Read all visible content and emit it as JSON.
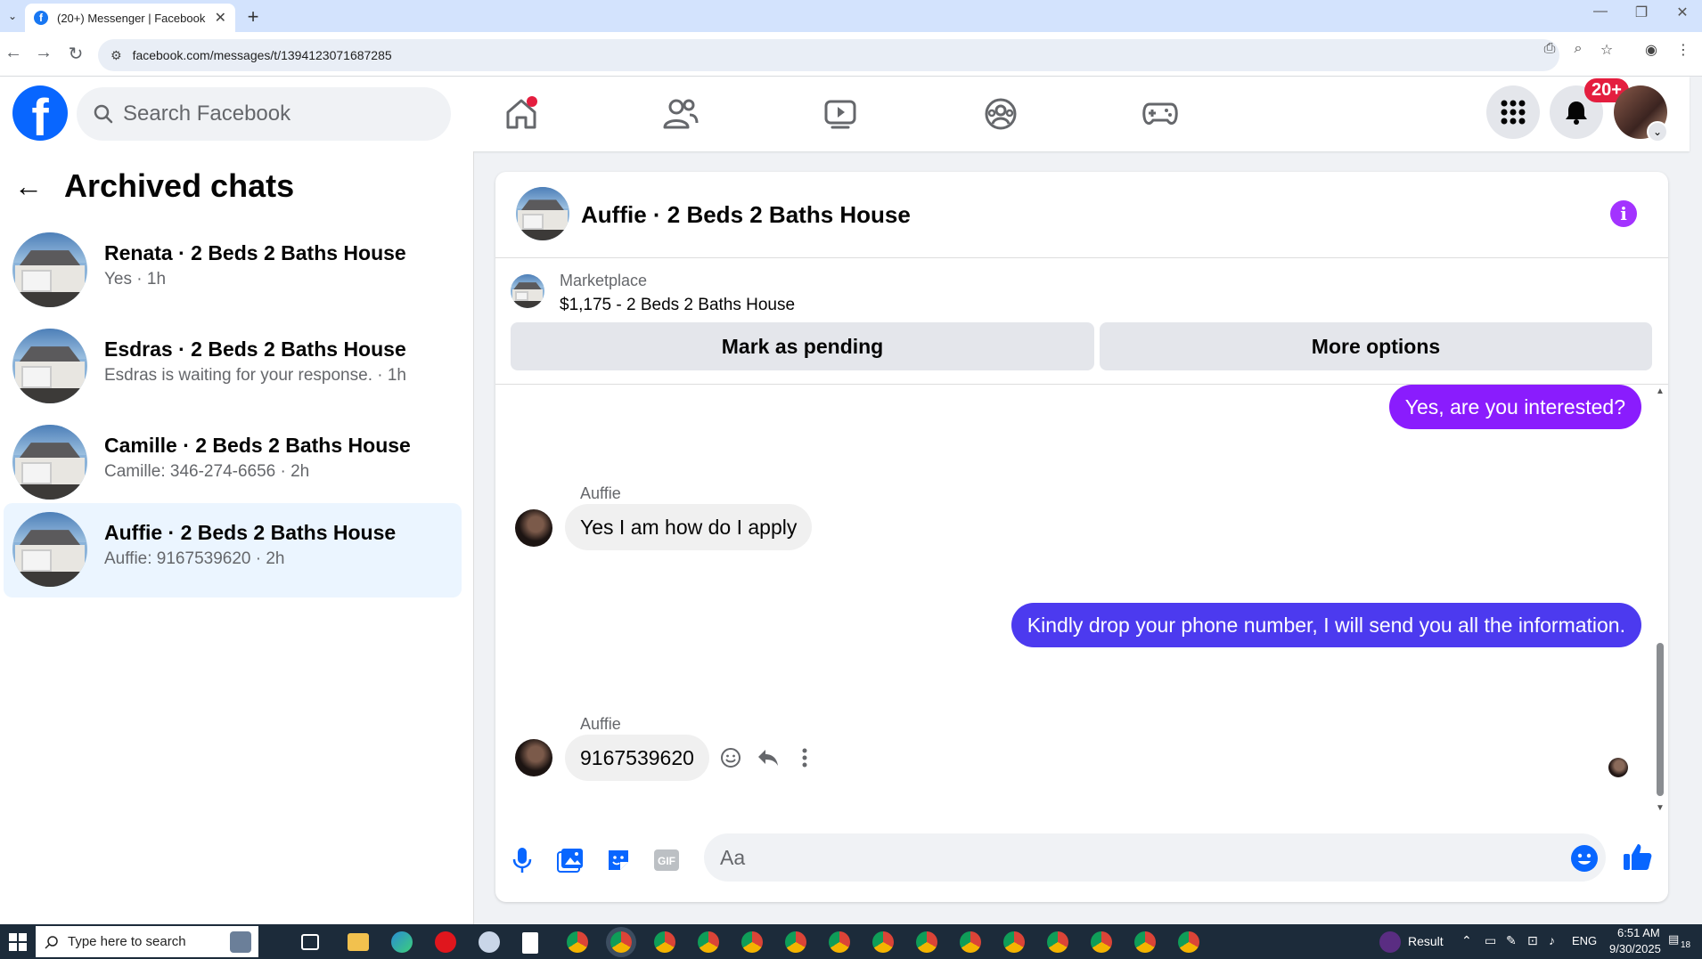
{
  "browser": {
    "tab_title": "(20+) Messenger | Facebook",
    "tab_favicon": "f",
    "url": "facebook.com/messages/t/1394123071687285"
  },
  "fb_header": {
    "logo": "f",
    "search_placeholder": "Search Facebook",
    "notification_badge": "20+"
  },
  "left_panel": {
    "title": "Archived chats",
    "chats": [
      {
        "name": "Renata · 2 Beds 2 Baths House",
        "preview": "Yes · 1h"
      },
      {
        "name": "Esdras · 2 Beds 2 Baths House",
        "preview": "Esdras is waiting for your response. · 1h"
      },
      {
        "name": "Camille · 2 Beds 2 Baths House",
        "preview": "Camille: 346-274-6656 · 2h"
      },
      {
        "name": "Auffie · 2 Beds 2 Baths House",
        "preview": "Auffie: 9167539620 · 2h"
      }
    ]
  },
  "conversation": {
    "title": "Auffie · 2 Beds 2 Baths House",
    "marketplace": {
      "label": "Marketplace",
      "listing": "$1,175 - 2 Beds 2 Baths House",
      "pending_button": "Mark as pending",
      "options_button": "More options"
    },
    "messages": [
      {
        "from": "me",
        "text": "Yes, are you interested?"
      },
      {
        "from": "Auffie",
        "sender_label": "Auffie",
        "text": "Yes I am how do I apply"
      },
      {
        "from": "me",
        "text": "Kindly drop your phone number, I will send you all the information."
      },
      {
        "from": "Auffie",
        "sender_label": "Auffie",
        "text": "9167539620"
      }
    ],
    "composer_placeholder": "Aa"
  },
  "taskbar": {
    "search_placeholder": "Type here to search",
    "result_label": "Result",
    "language": "ENG",
    "time": "6:51 AM",
    "date": "9/30/2025",
    "notification_count": "18"
  },
  "colors": {
    "facebook_blue": "#0866ff",
    "outgoing_purple": "#8a1cfd",
    "outgoing_blue": "#4c3aef",
    "badge_red": "#e41e3f",
    "selected_chat_bg": "#ebf5ff"
  }
}
